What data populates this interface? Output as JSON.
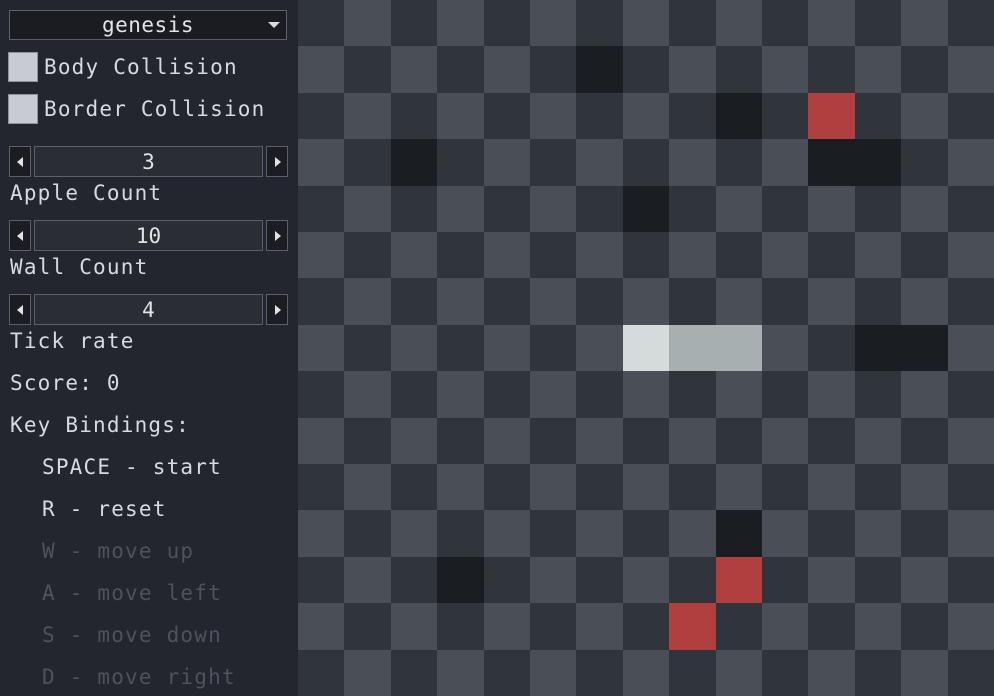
{
  "controls": {
    "mode_dropdown": {
      "selected": "genesis"
    },
    "body_collision": {
      "label": "Body Collision",
      "checked": false
    },
    "border_collision": {
      "label": "Border Collision",
      "checked": false
    },
    "apple_count": {
      "value": "3",
      "label": "Apple Count"
    },
    "wall_count": {
      "value": "10",
      "label": "Wall Count"
    },
    "tick_rate": {
      "value": "4",
      "label": "Tick rate"
    }
  },
  "score": "Score: 0",
  "key_bindings": {
    "title": "Key Bindings:",
    "items": [
      {
        "text": "SPACE - start",
        "enabled": true
      },
      {
        "text": "R - reset",
        "enabled": true
      },
      {
        "text": "W - move up",
        "enabled": false
      },
      {
        "text": "A - move left",
        "enabled": false
      },
      {
        "text": "S - move down",
        "enabled": false
      },
      {
        "text": "D - move right",
        "enabled": false
      }
    ]
  },
  "board": {
    "columns": 15,
    "rows": 15,
    "colors": {
      "light": "#4a4f57",
      "dark": "#30343b",
      "wall": "#1a1d21",
      "apple": "#b23f3f",
      "snake_head": "#d5dadb",
      "snake_body": "#a7afb0"
    },
    "snake": [
      [
        7,
        7
      ],
      [
        8,
        7
      ],
      [
        9,
        7
      ]
    ],
    "apples": [
      [
        11,
        2
      ],
      [
        9,
        12
      ],
      [
        8,
        13
      ]
    ],
    "walls": [
      [
        6,
        1
      ],
      [
        9,
        2
      ],
      [
        2,
        3
      ],
      [
        11,
        3
      ],
      [
        12,
        3
      ],
      [
        7,
        4
      ],
      [
        12,
        7
      ],
      [
        13,
        7
      ],
      [
        9,
        11
      ],
      [
        3,
        12
      ]
    ]
  }
}
